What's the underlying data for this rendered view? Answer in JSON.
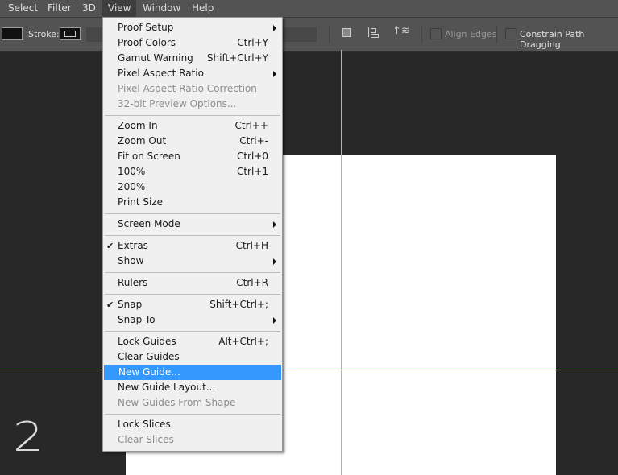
{
  "menubar": [
    "Select",
    "Filter",
    "3D",
    "View",
    "Window",
    "Help"
  ],
  "options": {
    "stroke_label": "Stroke:",
    "align_edges": "Align Edges",
    "constrain": "Constrain Path Dragging"
  },
  "canvas_number": "2",
  "menu": [
    [
      {
        "label": "Proof Setup",
        "sub": true
      },
      {
        "label": "Proof Colors",
        "sc": "Ctrl+Y"
      },
      {
        "label": "Gamut Warning",
        "sc": "Shift+Ctrl+Y"
      },
      {
        "label": "Pixel Aspect Ratio",
        "sub": true
      },
      {
        "label": "Pixel Aspect Ratio Correction",
        "dis": true
      },
      {
        "label": "32-bit Preview Options...",
        "dis": true
      }
    ],
    [
      {
        "label": "Zoom In",
        "sc": "Ctrl++"
      },
      {
        "label": "Zoom Out",
        "sc": "Ctrl+-"
      },
      {
        "label": "Fit on Screen",
        "sc": "Ctrl+0"
      },
      {
        "label": "100%",
        "sc": "Ctrl+1"
      },
      {
        "label": "200%"
      },
      {
        "label": "Print Size"
      }
    ],
    [
      {
        "label": "Screen Mode",
        "sub": true
      }
    ],
    [
      {
        "label": "Extras",
        "sc": "Ctrl+H",
        "check": true
      },
      {
        "label": "Show",
        "sub": true
      }
    ],
    [
      {
        "label": "Rulers",
        "sc": "Ctrl+R"
      }
    ],
    [
      {
        "label": "Snap",
        "sc": "Shift+Ctrl+;",
        "check": true
      },
      {
        "label": "Snap To",
        "sub": true
      }
    ],
    [
      {
        "label": "Lock Guides",
        "sc": "Alt+Ctrl+;"
      },
      {
        "label": "Clear Guides"
      },
      {
        "label": "New Guide...",
        "hl": true
      },
      {
        "label": "New Guide Layout..."
      },
      {
        "label": "New Guides From Shape",
        "dis": true
      }
    ],
    [
      {
        "label": "Lock Slices"
      },
      {
        "label": "Clear Slices",
        "dis": true
      }
    ]
  ]
}
